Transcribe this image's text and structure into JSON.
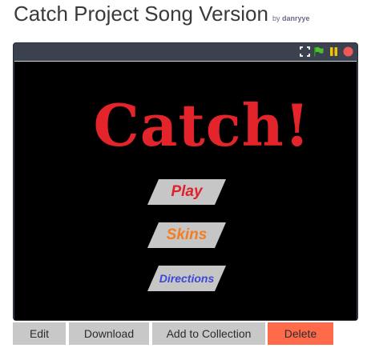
{
  "header": {
    "title": "Catch Project Song Version",
    "by_label": "by",
    "author": "danryye"
  },
  "player": {
    "controls": {
      "fullscreen_icon": "fullscreen-icon",
      "green_flag_icon": "green-flag-icon",
      "pause_icon": "pause-icon",
      "stop_icon": "stop-icon",
      "colors": {
        "flag": "#4cbf2f",
        "pause": "#f2c400",
        "stop": "#ee5a5a"
      }
    },
    "stage": {
      "game_title": "Catch!",
      "menu": {
        "play": "Play",
        "skins": "Skins",
        "directions": "Directions"
      },
      "colors": {
        "title": "#e3242b",
        "play": "#e0202a",
        "skins": "#f47d22",
        "directions": "#3b47d6"
      }
    }
  },
  "actions": {
    "edit": "Edit",
    "download": "Download",
    "add_to_collection": "Add to Collection",
    "delete": "Delete"
  }
}
